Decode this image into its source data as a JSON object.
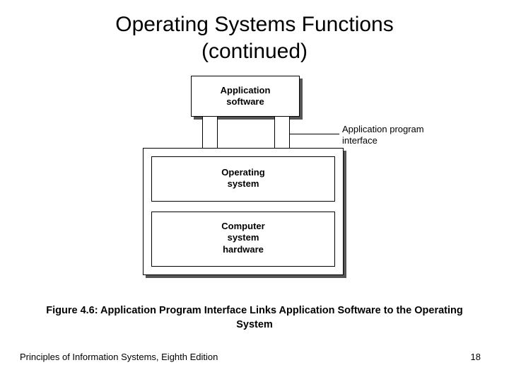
{
  "title_line1": "Operating Systems Functions",
  "title_line2": "(continued)",
  "diagram": {
    "app_label_1": "Application",
    "app_label_2": "software",
    "os_label_1": "Operating",
    "os_label_2": "system",
    "hw_label_1": "Computer",
    "hw_label_2": "system",
    "hw_label_3": "hardware",
    "api_label_1": "Application program",
    "api_label_2": "interface"
  },
  "caption": "Figure 4.6: Application Program Interface Links Application Software to the Operating System",
  "footer_left": "Principles of Information Systems, Eighth Edition",
  "footer_right": "18"
}
